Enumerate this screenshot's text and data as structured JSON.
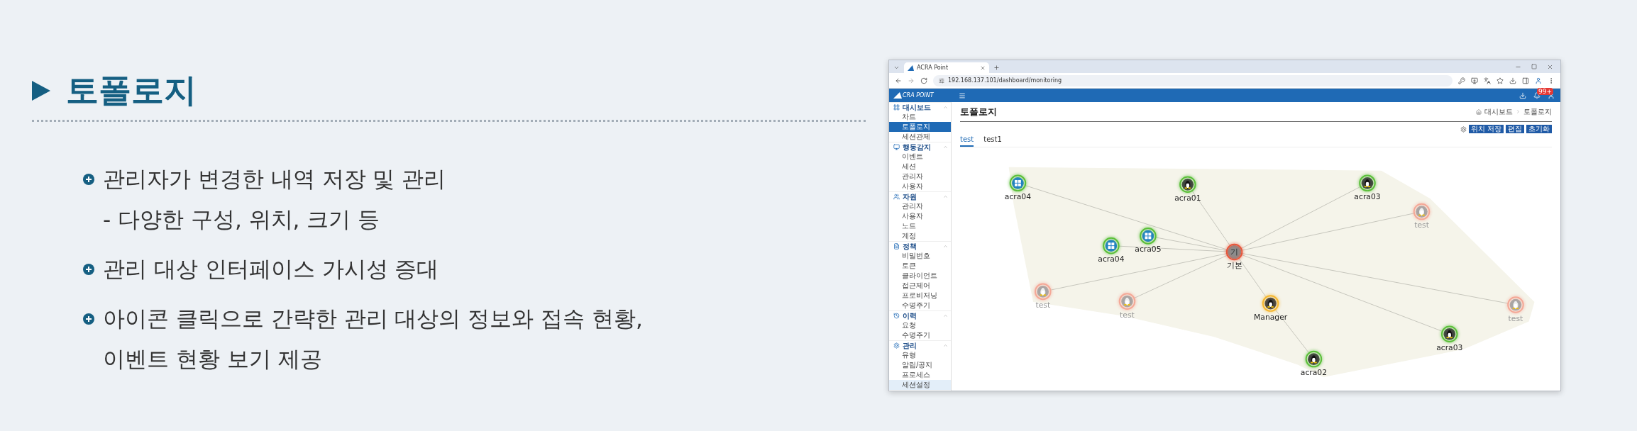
{
  "slide": {
    "title": "토폴로지",
    "bullets": [
      {
        "lines": [
          "관리자가 변경한 내역 저장 및 관리",
          "- 다양한 구성, 위치, 크기 등"
        ]
      },
      {
        "lines": [
          "관리 대상 인터페이스 가시성 증대"
        ]
      },
      {
        "lines": [
          "아이콘 클릭으로 간략한 관리 대상의 정보와 접속 현황,",
          "이벤트 현황 보기 제공"
        ]
      }
    ]
  },
  "browser": {
    "tab_title": "ACRA Point",
    "url": "192.168.137.101/dashboard/monitoring"
  },
  "app": {
    "logo": "CRA POINT",
    "notification_badge": "99+",
    "sidebar": [
      {
        "label": "대시보드",
        "kind": "dashboard",
        "expanded": true,
        "items": [
          {
            "label": "차트",
            "selected": false,
            "hovered": false
          },
          {
            "label": "토폴로지",
            "selected": true,
            "hovered": false
          },
          {
            "label": "세션관제",
            "selected": false,
            "hovered": false
          }
        ]
      },
      {
        "label": "행동감지",
        "kind": "monitor",
        "expanded": true,
        "items": [
          {
            "label": "이벤트",
            "selected": false,
            "hovered": false
          },
          {
            "label": "세션",
            "selected": false,
            "hovered": false
          },
          {
            "label": "관리자",
            "selected": false,
            "hovered": false
          },
          {
            "label": "사용자",
            "selected": false,
            "hovered": false
          }
        ]
      },
      {
        "label": "자원",
        "kind": "resource",
        "expanded": true,
        "items": [
          {
            "label": "관리자",
            "selected": false,
            "hovered": false
          },
          {
            "label": "사용자",
            "selected": false,
            "hovered": false
          },
          {
            "label": "노드",
            "selected": false,
            "hovered": false
          },
          {
            "label": "계정",
            "selected": false,
            "hovered": false
          }
        ]
      },
      {
        "label": "정책",
        "kind": "policy",
        "expanded": true,
        "items": [
          {
            "label": "비밀번호",
            "selected": false,
            "hovered": false
          },
          {
            "label": "토큰",
            "selected": false,
            "hovered": false
          },
          {
            "label": "클라이언트",
            "selected": false,
            "hovered": false
          },
          {
            "label": "접근제어",
            "selected": false,
            "hovered": false
          },
          {
            "label": "프로비저닝",
            "selected": false,
            "hovered": false
          },
          {
            "label": "수명주기",
            "selected": false,
            "hovered": false
          }
        ]
      },
      {
        "label": "이력",
        "kind": "history",
        "expanded": true,
        "items": [
          {
            "label": "요청",
            "selected": false,
            "hovered": false
          },
          {
            "label": "수명주기",
            "selected": false,
            "hovered": false
          }
        ]
      },
      {
        "label": "관리",
        "kind": "settings",
        "expanded": true,
        "items": [
          {
            "label": "유형",
            "selected": false,
            "hovered": false
          },
          {
            "label": "알림/공지",
            "selected": false,
            "hovered": false
          },
          {
            "label": "프로세스",
            "selected": false,
            "hovered": false
          },
          {
            "label": "세션설정",
            "selected": false,
            "hovered": true
          }
        ]
      }
    ],
    "page": {
      "title": "토폴로지",
      "breadcrumbs": [
        "대시보드",
        "토폴로지"
      ],
      "buttons": [
        "위치 저장",
        "편집",
        "초기화"
      ],
      "tabs": [
        {
          "label": "test",
          "selected": true
        },
        {
          "label": "test1",
          "selected": false
        }
      ],
      "topology": {
        "root": {
          "label": "기본",
          "glyph": "기",
          "kind": "group",
          "color": "#e8553a",
          "disabled": false,
          "children": [
            {
              "label": "acra04",
              "kind": "windows",
              "color": "#5bbf3a",
              "disabled": false
            },
            {
              "label": "acra01",
              "kind": "linux",
              "color": "#5bbf3a",
              "disabled": false
            },
            {
              "label": "acra03",
              "kind": "linux",
              "color": "#5bbf3a",
              "disabled": false
            },
            {
              "label": "test",
              "kind": "linux",
              "color": "#f4a897",
              "disabled": true
            },
            {
              "label": "acra05",
              "kind": "windows",
              "color": "#5bbf3a",
              "disabled": false
            },
            {
              "label": "acra04",
              "kind": "windows",
              "color": "#5bbf3a",
              "disabled": false
            },
            {
              "label": "test",
              "kind": "linux",
              "color": "#f4a897",
              "disabled": true
            },
            {
              "label": "test",
              "kind": "linux",
              "color": "#f4a897",
              "disabled": true
            },
            {
              "label": "Manager",
              "kind": "linux",
              "color": "#f5b731",
              "disabled": false,
              "children": [
                {
                  "label": "acra02",
                  "kind": "linux",
                  "color": "#5bbf3a",
                  "disabled": false
                }
              ]
            },
            {
              "label": "test",
              "kind": "linux",
              "color": "#f4a897",
              "disabled": true
            },
            {
              "label": "acra03",
              "kind": "linux",
              "color": "#5bbf3a",
              "disabled": false
            }
          ]
        }
      }
    }
  }
}
